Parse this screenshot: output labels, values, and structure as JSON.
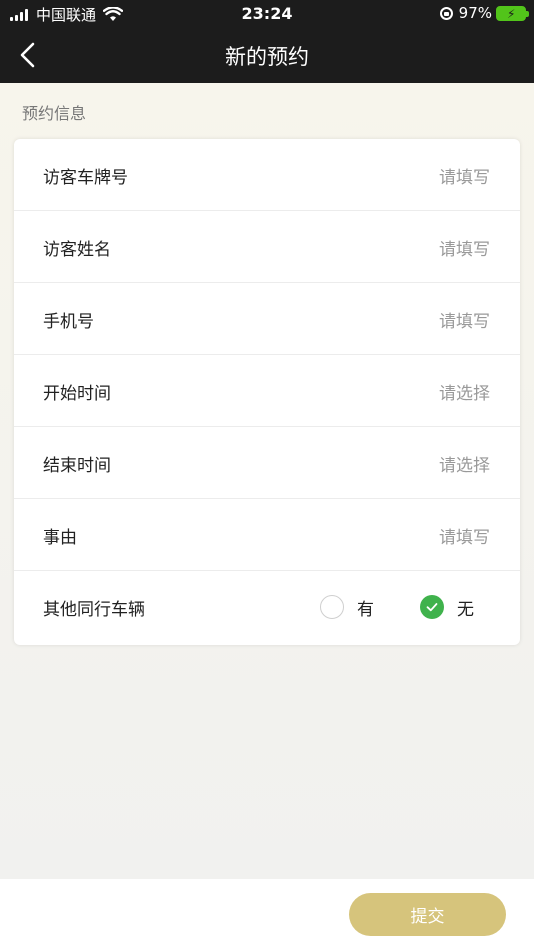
{
  "status_bar": {
    "carrier": "中国联通",
    "time": "23:24",
    "battery": "97%"
  },
  "nav": {
    "title": "新的预约"
  },
  "section": {
    "title": "预约信息"
  },
  "form": {
    "rows": [
      {
        "label": "访客车牌号",
        "placeholder": "请填写"
      },
      {
        "label": "访客姓名",
        "placeholder": "请填写"
      },
      {
        "label": "手机号",
        "placeholder": "请填写"
      },
      {
        "label": "开始时间",
        "placeholder": "请选择"
      },
      {
        "label": "结束时间",
        "placeholder": "请选择"
      },
      {
        "label": "事由",
        "placeholder": "请填写"
      }
    ],
    "companion": {
      "label": "其他同行车辆",
      "option_yes": "有",
      "option_no": "无",
      "selected": "无"
    }
  },
  "footer": {
    "submit_label": "提交"
  },
  "colors": {
    "topbar": "#1c1c1c",
    "accent_green": "#3fb24c",
    "submit_gold": "#d6c47c"
  }
}
